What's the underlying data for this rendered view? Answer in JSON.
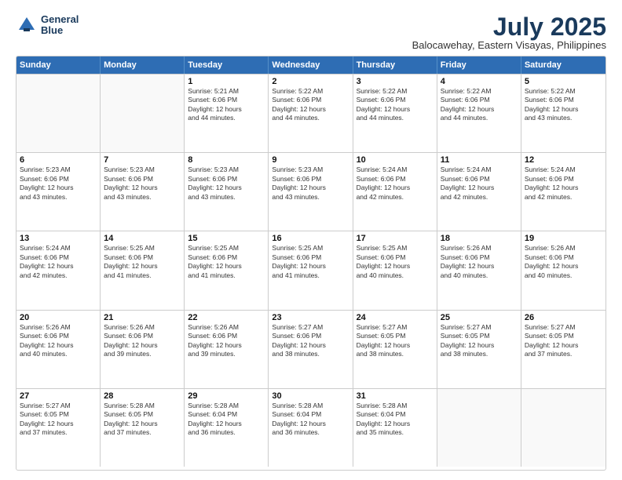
{
  "header": {
    "logo_line1": "General",
    "logo_line2": "Blue",
    "title": "July 2025",
    "subtitle": "Balocawehay, Eastern Visayas, Philippines"
  },
  "calendar": {
    "weekdays": [
      "Sunday",
      "Monday",
      "Tuesday",
      "Wednesday",
      "Thursday",
      "Friday",
      "Saturday"
    ],
    "rows": [
      [
        {
          "day": "",
          "lines": [],
          "empty": true
        },
        {
          "day": "",
          "lines": [],
          "empty": true
        },
        {
          "day": "1",
          "lines": [
            "Sunrise: 5:21 AM",
            "Sunset: 6:06 PM",
            "Daylight: 12 hours",
            "and 44 minutes."
          ],
          "empty": false
        },
        {
          "day": "2",
          "lines": [
            "Sunrise: 5:22 AM",
            "Sunset: 6:06 PM",
            "Daylight: 12 hours",
            "and 44 minutes."
          ],
          "empty": false
        },
        {
          "day": "3",
          "lines": [
            "Sunrise: 5:22 AM",
            "Sunset: 6:06 PM",
            "Daylight: 12 hours",
            "and 44 minutes."
          ],
          "empty": false
        },
        {
          "day": "4",
          "lines": [
            "Sunrise: 5:22 AM",
            "Sunset: 6:06 PM",
            "Daylight: 12 hours",
            "and 44 minutes."
          ],
          "empty": false
        },
        {
          "day": "5",
          "lines": [
            "Sunrise: 5:22 AM",
            "Sunset: 6:06 PM",
            "Daylight: 12 hours",
            "and 43 minutes."
          ],
          "empty": false
        }
      ],
      [
        {
          "day": "6",
          "lines": [
            "Sunrise: 5:23 AM",
            "Sunset: 6:06 PM",
            "Daylight: 12 hours",
            "and 43 minutes."
          ],
          "empty": false
        },
        {
          "day": "7",
          "lines": [
            "Sunrise: 5:23 AM",
            "Sunset: 6:06 PM",
            "Daylight: 12 hours",
            "and 43 minutes."
          ],
          "empty": false
        },
        {
          "day": "8",
          "lines": [
            "Sunrise: 5:23 AM",
            "Sunset: 6:06 PM",
            "Daylight: 12 hours",
            "and 43 minutes."
          ],
          "empty": false
        },
        {
          "day": "9",
          "lines": [
            "Sunrise: 5:23 AM",
            "Sunset: 6:06 PM",
            "Daylight: 12 hours",
            "and 43 minutes."
          ],
          "empty": false
        },
        {
          "day": "10",
          "lines": [
            "Sunrise: 5:24 AM",
            "Sunset: 6:06 PM",
            "Daylight: 12 hours",
            "and 42 minutes."
          ],
          "empty": false
        },
        {
          "day": "11",
          "lines": [
            "Sunrise: 5:24 AM",
            "Sunset: 6:06 PM",
            "Daylight: 12 hours",
            "and 42 minutes."
          ],
          "empty": false
        },
        {
          "day": "12",
          "lines": [
            "Sunrise: 5:24 AM",
            "Sunset: 6:06 PM",
            "Daylight: 12 hours",
            "and 42 minutes."
          ],
          "empty": false
        }
      ],
      [
        {
          "day": "13",
          "lines": [
            "Sunrise: 5:24 AM",
            "Sunset: 6:06 PM",
            "Daylight: 12 hours",
            "and 42 minutes."
          ],
          "empty": false
        },
        {
          "day": "14",
          "lines": [
            "Sunrise: 5:25 AM",
            "Sunset: 6:06 PM",
            "Daylight: 12 hours",
            "and 41 minutes."
          ],
          "empty": false
        },
        {
          "day": "15",
          "lines": [
            "Sunrise: 5:25 AM",
            "Sunset: 6:06 PM",
            "Daylight: 12 hours",
            "and 41 minutes."
          ],
          "empty": false
        },
        {
          "day": "16",
          "lines": [
            "Sunrise: 5:25 AM",
            "Sunset: 6:06 PM",
            "Daylight: 12 hours",
            "and 41 minutes."
          ],
          "empty": false
        },
        {
          "day": "17",
          "lines": [
            "Sunrise: 5:25 AM",
            "Sunset: 6:06 PM",
            "Daylight: 12 hours",
            "and 40 minutes."
          ],
          "empty": false
        },
        {
          "day": "18",
          "lines": [
            "Sunrise: 5:26 AM",
            "Sunset: 6:06 PM",
            "Daylight: 12 hours",
            "and 40 minutes."
          ],
          "empty": false
        },
        {
          "day": "19",
          "lines": [
            "Sunrise: 5:26 AM",
            "Sunset: 6:06 PM",
            "Daylight: 12 hours",
            "and 40 minutes."
          ],
          "empty": false
        }
      ],
      [
        {
          "day": "20",
          "lines": [
            "Sunrise: 5:26 AM",
            "Sunset: 6:06 PM",
            "Daylight: 12 hours",
            "and 40 minutes."
          ],
          "empty": false
        },
        {
          "day": "21",
          "lines": [
            "Sunrise: 5:26 AM",
            "Sunset: 6:06 PM",
            "Daylight: 12 hours",
            "and 39 minutes."
          ],
          "empty": false
        },
        {
          "day": "22",
          "lines": [
            "Sunrise: 5:26 AM",
            "Sunset: 6:06 PM",
            "Daylight: 12 hours",
            "and 39 minutes."
          ],
          "empty": false
        },
        {
          "day": "23",
          "lines": [
            "Sunrise: 5:27 AM",
            "Sunset: 6:06 PM",
            "Daylight: 12 hours",
            "and 38 minutes."
          ],
          "empty": false
        },
        {
          "day": "24",
          "lines": [
            "Sunrise: 5:27 AM",
            "Sunset: 6:05 PM",
            "Daylight: 12 hours",
            "and 38 minutes."
          ],
          "empty": false
        },
        {
          "day": "25",
          "lines": [
            "Sunrise: 5:27 AM",
            "Sunset: 6:05 PM",
            "Daylight: 12 hours",
            "and 38 minutes."
          ],
          "empty": false
        },
        {
          "day": "26",
          "lines": [
            "Sunrise: 5:27 AM",
            "Sunset: 6:05 PM",
            "Daylight: 12 hours",
            "and 37 minutes."
          ],
          "empty": false
        }
      ],
      [
        {
          "day": "27",
          "lines": [
            "Sunrise: 5:27 AM",
            "Sunset: 6:05 PM",
            "Daylight: 12 hours",
            "and 37 minutes."
          ],
          "empty": false
        },
        {
          "day": "28",
          "lines": [
            "Sunrise: 5:28 AM",
            "Sunset: 6:05 PM",
            "Daylight: 12 hours",
            "and 37 minutes."
          ],
          "empty": false
        },
        {
          "day": "29",
          "lines": [
            "Sunrise: 5:28 AM",
            "Sunset: 6:04 PM",
            "Daylight: 12 hours",
            "and 36 minutes."
          ],
          "empty": false
        },
        {
          "day": "30",
          "lines": [
            "Sunrise: 5:28 AM",
            "Sunset: 6:04 PM",
            "Daylight: 12 hours",
            "and 36 minutes."
          ],
          "empty": false
        },
        {
          "day": "31",
          "lines": [
            "Sunrise: 5:28 AM",
            "Sunset: 6:04 PM",
            "Daylight: 12 hours",
            "and 35 minutes."
          ],
          "empty": false
        },
        {
          "day": "",
          "lines": [],
          "empty": true
        },
        {
          "day": "",
          "lines": [],
          "empty": true
        }
      ]
    ]
  }
}
